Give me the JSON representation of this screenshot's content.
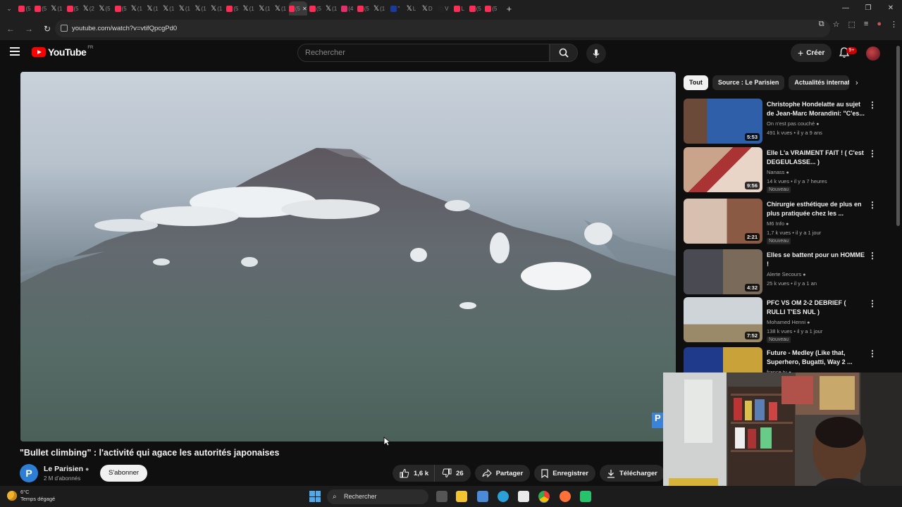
{
  "browser": {
    "url": "youtube.com/watch?v=vtifQpcgPd0",
    "new_tab": "+",
    "tabs": [
      {
        "fav": "#ff2d55",
        "txt": "(5"
      },
      {
        "fav": "#ff2d55",
        "txt": "(5"
      },
      {
        "fav": "x",
        "txt": "(1"
      },
      {
        "fav": "#ff2d55",
        "txt": "(5"
      },
      {
        "fav": "x",
        "txt": "(2"
      },
      {
        "fav": "x",
        "txt": "(5"
      },
      {
        "fav": "#ff2d55",
        "txt": "(5"
      },
      {
        "fav": "x",
        "txt": "(1"
      },
      {
        "fav": "x",
        "txt": "(1"
      },
      {
        "fav": "x",
        "txt": "(1"
      },
      {
        "fav": "x",
        "txt": "(1"
      },
      {
        "fav": "x",
        "txt": "(1"
      },
      {
        "fav": "x",
        "txt": "(1"
      },
      {
        "fav": "#ff2d55",
        "txt": "(5"
      },
      {
        "fav": "x",
        "txt": "(1"
      },
      {
        "fav": "x",
        "txt": "(1"
      },
      {
        "fav": "x",
        "txt": "(1"
      },
      {
        "fav": "#ff2d55",
        "txt": "(5",
        "active": true
      },
      {
        "fav": "#ff2d55",
        "txt": "(5"
      },
      {
        "fav": "x",
        "txt": "(1"
      },
      {
        "fav": "#e1306c",
        "txt": "(4"
      },
      {
        "fav": "#ff2d55",
        "txt": "(5"
      },
      {
        "fav": "x",
        "txt": "(1"
      },
      {
        "fav": "#1a3a9e",
        "txt": "\""
      },
      {
        "fav": "x",
        "txt": "L"
      },
      {
        "fav": "x",
        "txt": "D"
      },
      {
        "fav": "#222222",
        "txt": "V"
      },
      {
        "fav": "#ff2d55",
        "txt": "L"
      },
      {
        "fav": "#ff2d55",
        "txt": "(5"
      },
      {
        "fav": "#ff2d55",
        "txt": "(5"
      }
    ]
  },
  "youtube": {
    "logo": "YouTube",
    "country": "FR",
    "search_placeholder": "Rechercher",
    "create_label": "Créer",
    "notif_count": "9+"
  },
  "video": {
    "title": "\"Bullet climbing\" : l'activité qui agace les autorités japonaises",
    "channel_name": "Le Parisien",
    "channel_initial": "P",
    "subscribers": "2 M d'abonnés",
    "subscribe_label": "S'abonner",
    "likes": "1,6 k",
    "dislikes": "26",
    "share_label": "Partager",
    "save_label": "Enregistrer",
    "download_label": "Télécharger",
    "corner_tag": "P"
  },
  "chips": [
    "Tout",
    "Source : Le Parisien",
    "Actualités internati"
  ],
  "recommendations": [
    {
      "title": "Christophe Hondelatte au sujet de Jean-Marc Morandini: \"C'es...",
      "channel": "On n'est pas couché",
      "meta": "491 k vues • il y a 9 ans",
      "duration": "5:53",
      "new": ""
    },
    {
      "title": "Elle L'a VRAIMENT FAIT ! ( C'est DEGEULASSE... )",
      "channel": "Nanass",
      "meta": "14 k vues • il y a 7 heures",
      "duration": "9:56",
      "new": "Nouveau"
    },
    {
      "title": "Chirurgie esthétique de plus en plus pratiquée chez les ...",
      "channel": "M6 Info",
      "meta": "1,7 k vues • il y a 1 jour",
      "duration": "2:21",
      "new": "Nouveau"
    },
    {
      "title": "Elles se battent pour un HOMME !",
      "channel": "Alerte Secours",
      "meta": "25 k vues • il y a 1 an",
      "duration": "4:32",
      "new": ""
    },
    {
      "title": "PFC VS OM 2-2 DEBRIEF ( RULLI T'ES NUL )",
      "channel": "Mohamed Henni",
      "meta": "138 k vues • il y a 1 jour",
      "duration": "7:52",
      "new": "Nouveau"
    },
    {
      "title": "Future - Medley (Like that, Superhero, Bugatti, Way 2 ...",
      "channel": "france.tv",
      "meta": "",
      "duration": "",
      "new": ""
    }
  ],
  "taskbar": {
    "temp": "6°C",
    "weather": "Temps dégagé",
    "search_label": "Rechercher"
  }
}
